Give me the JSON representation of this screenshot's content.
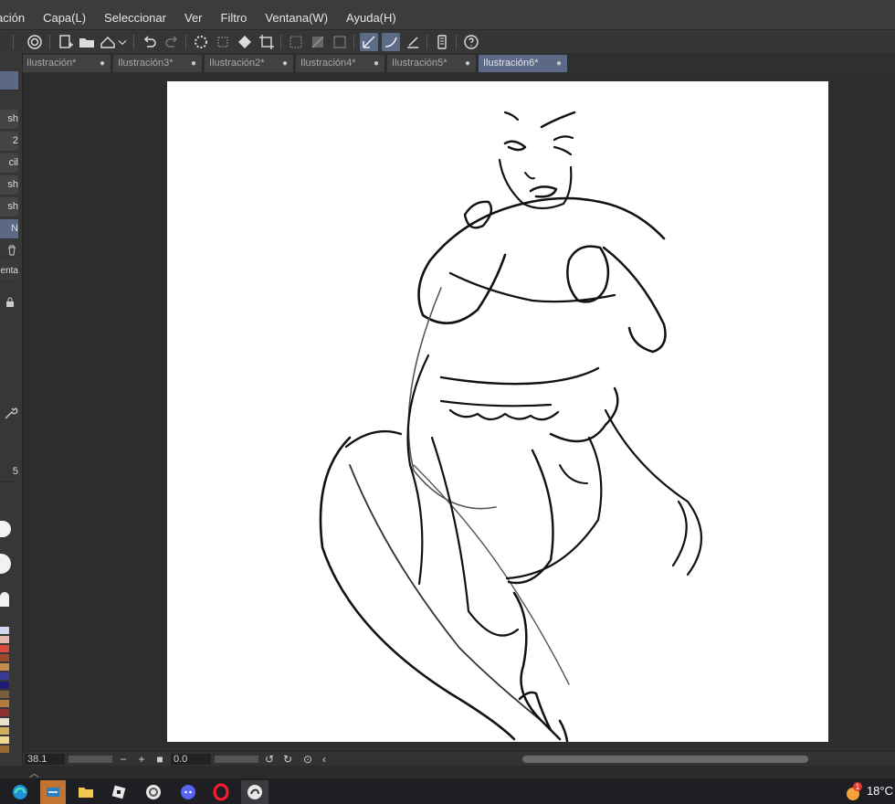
{
  "menu": {
    "items": [
      "ación",
      "Capa(L)",
      "Seleccionar",
      "Ver",
      "Filtro",
      "Ventana(W)",
      "Ayuda(H)"
    ]
  },
  "tabs": [
    {
      "label": "Ilustración*",
      "active": false
    },
    {
      "label": "Ilustración3*",
      "active": false
    },
    {
      "label": "Ilustración2*",
      "active": false
    },
    {
      "label": "Ilustración4*",
      "active": false
    },
    {
      "label": "Ilustración5*",
      "active": false
    },
    {
      "label": "Ilustración6*",
      "active": true
    }
  ],
  "tab_close_glyph": "●",
  "left_panel": {
    "tool_labels": [
      "sh",
      "2",
      "cil",
      "sh",
      "sh",
      "N"
    ],
    "section_label": "enta",
    "size_value": "5"
  },
  "status": {
    "zoom": "38.1",
    "rotation": "0.0"
  },
  "taskbar": {
    "icons": [
      "edge-icon",
      "photopea-icon",
      "file-explorer-icon",
      "roblox-icon",
      "clip-studio-icon",
      "discord-icon",
      "opera-icon",
      "clip-studio-paint-icon"
    ],
    "weather_badge": "1",
    "temperature": "18°C"
  },
  "colors": {
    "accent": "#5b6886",
    "background": "#2b2b2b",
    "canvas": "#ffffff",
    "palette": [
      "#cfd8ef",
      "#e6b7b0",
      "#d94b3d",
      "#9c4a2b",
      "#c78a4f",
      "#3a3a9a",
      "#1e1e7a",
      "#7a5e3a",
      "#b57a3d",
      "#8f2f2f",
      "#e8e0c8",
      "#d0b060",
      "#f0d890",
      "#9a6a30"
    ]
  }
}
